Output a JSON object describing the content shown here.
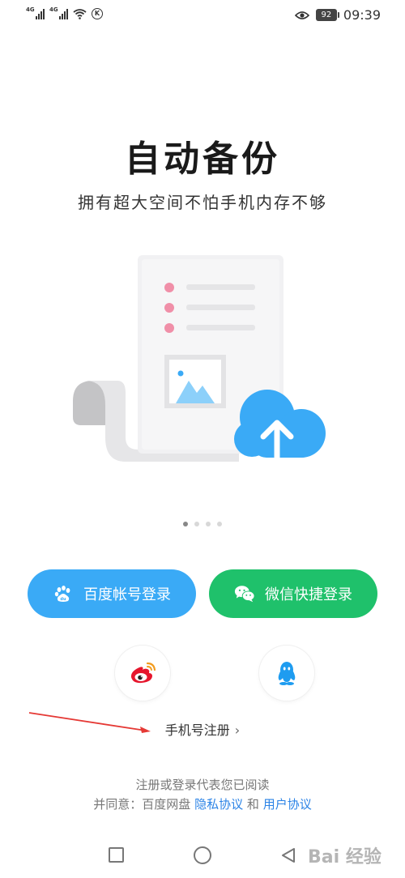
{
  "status_bar": {
    "network_1": "4G",
    "network_2": "4G",
    "battery": "92",
    "time": "09:39"
  },
  "intro": {
    "title": "自动备份",
    "subtitle": "拥有超大空间不怕手机内存不够"
  },
  "pager": {
    "total": 4,
    "active_index": 0
  },
  "login": {
    "baidu_label": "百度帐号登录",
    "wechat_label": "微信快捷登录"
  },
  "social": {
    "weibo_icon": "weibo-icon",
    "qq_icon": "qq-icon"
  },
  "phone_register": {
    "label": "手机号注册",
    "chevron": "›"
  },
  "agreement": {
    "line1": "注册或登录代表您已阅读",
    "line2_prefix": "并同意：百度网盘",
    "privacy_link": "隐私协议",
    "and": "和",
    "user_link": "用户协议"
  },
  "watermark": "Bai 经验",
  "colors": {
    "baidu_blue": "#3aaaf6",
    "wechat_green": "#1fc16b",
    "link_blue": "#2b83e6",
    "annotation_red": "#e53935"
  }
}
